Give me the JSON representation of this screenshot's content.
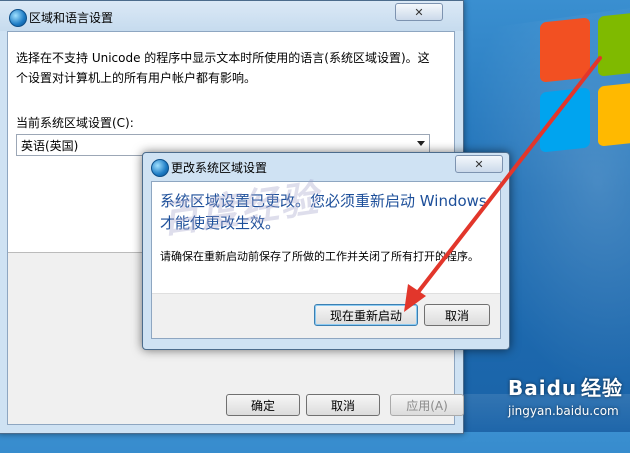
{
  "main_dialog": {
    "title": "区域和语言设置",
    "close_label": "✕",
    "description": "选择在不支持 Unicode 的程序中显示文本时所使用的语言(系统区域设置)。这个设置对计算机上的所有用户帐户都有影响。",
    "current_label": "当前系统区域设置(C):",
    "current_value": "英语(英国)",
    "buttons": {
      "ok": "确定",
      "cancel": "取消",
      "apply": "应用(A)"
    }
  },
  "change_dialog": {
    "title": "更改系统区域设置",
    "close_label": "✕",
    "headline": "系统区域设置已更改。您必须重新启动 Windows 才能使更改生效。",
    "warning": "请确保在重新启动前保存了所做的工作并关闭了所有打开的程序。",
    "buttons": {
      "restart": "现在重新启动",
      "cancel": "取消"
    }
  },
  "watermark": "百度经验",
  "baidu": {
    "logo_text": "Baidu",
    "jingyan": "经验",
    "url": "jingyan.baidu.com"
  },
  "colors": {
    "accent_arrow": "#e2362b",
    "headline": "#1d4f9a",
    "desktop": "#1f6fb5"
  }
}
